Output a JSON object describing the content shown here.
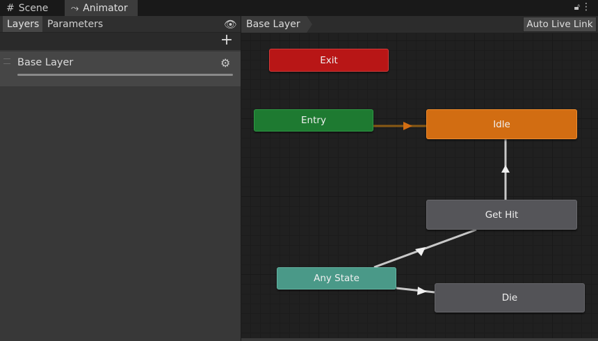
{
  "window": {
    "tabs": [
      {
        "label": "Scene",
        "icon": "hash-icon"
      },
      {
        "label": "Animator",
        "icon": "animator-icon"
      }
    ],
    "active_tab": "Animator"
  },
  "layers_panel": {
    "subtabs": [
      "Layers",
      "Parameters"
    ],
    "active_subtab": "Layers",
    "layers": [
      {
        "name": "Base Layer",
        "weight": 1.0
      }
    ]
  },
  "graph": {
    "breadcrumb": "Base Layer",
    "auto_live_link_label": "Auto Live Link",
    "states": {
      "exit": {
        "label": "Exit",
        "color": "#b81616"
      },
      "entry": {
        "label": "Entry",
        "color": "#1e7a31"
      },
      "idle": {
        "label": "Idle",
        "color": "#d26d12",
        "default": true
      },
      "get_hit": {
        "label": "Get Hit",
        "color": "#555559"
      },
      "any_state": {
        "label": "Any State",
        "color": "#4a9988"
      },
      "die": {
        "label": "Die",
        "color": "#535357"
      }
    },
    "transitions": [
      {
        "from": "Entry",
        "to": "Idle",
        "color": "#d26d12"
      },
      {
        "from": "Get Hit",
        "to": "Idle",
        "color": "#dcdcdc"
      },
      {
        "from": "Any State",
        "to": "Get Hit",
        "color": "#dcdcdc"
      },
      {
        "from": "Any State",
        "to": "Die",
        "color": "#dcdcdc"
      }
    ]
  }
}
